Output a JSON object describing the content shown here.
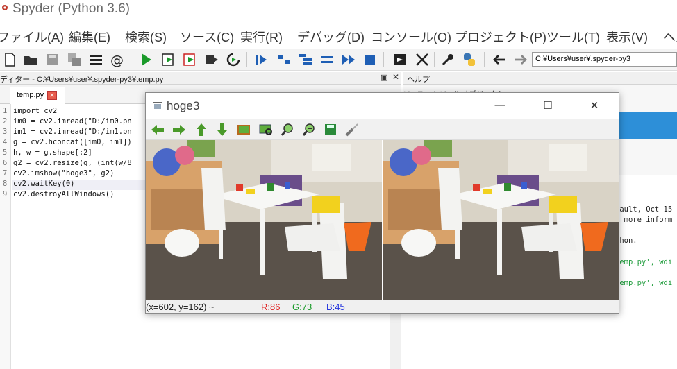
{
  "app": {
    "title": "Spyder (Python 3.6)"
  },
  "menu": [
    {
      "label": "ファイル(A)"
    },
    {
      "label": "編集(E)"
    },
    {
      "label": "検索(S)"
    },
    {
      "label": "ソース(C)"
    },
    {
      "label": "実行(R)"
    },
    {
      "label": "デバッグ(D)"
    },
    {
      "label": "コンソール(O)"
    },
    {
      "label": "プロジェクト(P)"
    },
    {
      "label": "ツール(T)"
    },
    {
      "label": "表示(V)"
    },
    {
      "label": "ヘル"
    }
  ],
  "toolbar": {
    "path": "C:¥Users¥user¥.spyder-py3"
  },
  "editor": {
    "title": "ディター - C:¥Users¥user¥.spyder-py3¥temp.py",
    "undock_icon": "▣",
    "close_icon": "✕",
    "tab_label": "temp.py",
    "tab_close": "x",
    "lines": [
      {
        "no": "1",
        "text": "import cv2"
      },
      {
        "no": "2",
        "text": "im0 = cv2.imread(\"D:/im0.pn"
      },
      {
        "no": "3",
        "text": "im1 = cv2.imread(\"D:/im1.pn"
      },
      {
        "no": "4",
        "text": "g = cv2.hconcat([im0, im1])"
      },
      {
        "no": "5",
        "text": "h, w = g.shape[:2]"
      },
      {
        "no": "6",
        "text": "g2 = cv2.resize(g, (int(w/8"
      },
      {
        "no": "7",
        "text": "cv2.imshow(\"hoge3\", g2)"
      },
      {
        "no": "8",
        "text": "cv2.waitKey(0)"
      },
      {
        "no": "9",
        "text": "cv2.destroyAllWindows()"
      }
    ]
  },
  "help": {
    "title": "ヘルプ",
    "source_label": "ソース  コンソール  オブジェクト"
  },
  "console": {
    "lines": [
      {
        "text": "fault, Oct 15",
        "green": false
      },
      {
        "text": "r more inform",
        "green": false
      },
      {
        "text": "thon.",
        "green": false
      },
      {
        "text": "temp.py', wdi",
        "green": true
      },
      {
        "text": "temp.py', wdi",
        "green": true
      }
    ]
  },
  "cv_window": {
    "title": "hoge3",
    "minimize": "—",
    "maximize": "☐",
    "close": "✕",
    "status": {
      "coords": "(x=602, y=162) ~",
      "r": "R:86",
      "g": "G:73",
      "b": "B:45"
    },
    "tools": [
      "pan-left-icon",
      "pan-right-icon",
      "pan-up-icon",
      "pan-down-icon",
      "zoom-fit-icon",
      "zoom-region-icon",
      "zoom-in-icon",
      "zoom-out-icon",
      "save-icon",
      "properties-icon"
    ]
  }
}
